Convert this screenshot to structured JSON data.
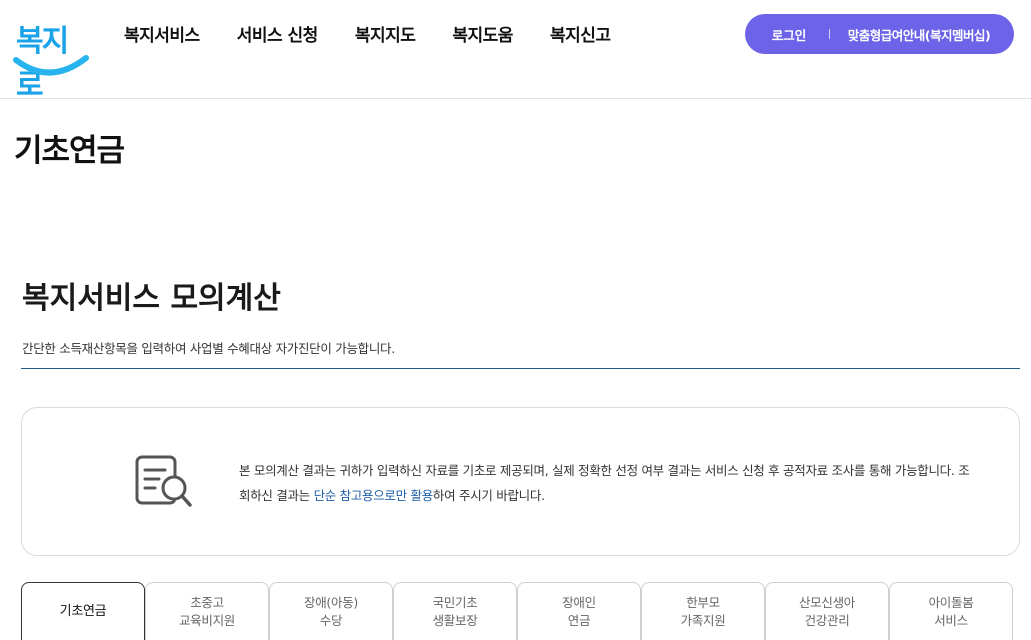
{
  "header": {
    "logo_text": "복지로",
    "nav": [
      "복지서비스",
      "서비스 신청",
      "복지지도",
      "복지도움",
      "복지신고"
    ],
    "login_label": "로그인",
    "member_label": "맞춤형급여안내(복지멤버십)",
    "accent_color": "#6c63e8"
  },
  "page": {
    "title": "기초연금"
  },
  "section": {
    "title": "복지서비스 모의계산",
    "description": "간단한 소득재산항목을 입력하여 사업별 수혜대상 자가진단이 가능합니다."
  },
  "notice": {
    "icon": "document-search-icon",
    "text_part1": "본 모의계산 결과는 귀하가 입력하신 자료를 기초로 제공되며, 실제 정확한 선정 여부 결과는 서비스 신청 후 공적자료 조사를 통해 가능합니다. 조회하신 결과는 ",
    "text_highlight": "단순 참고용으로만 활용",
    "text_part2": "하여 주시기 바랍니다."
  },
  "tabs": [
    {
      "lines": [
        "기초연금"
      ],
      "active": true
    },
    {
      "lines": [
        "초중고",
        "교육비지원"
      ],
      "active": false
    },
    {
      "lines": [
        "장애(아동)",
        "수당"
      ],
      "active": false
    },
    {
      "lines": [
        "국민기초",
        "생활보장"
      ],
      "active": false
    },
    {
      "lines": [
        "장애인",
        "연금"
      ],
      "active": false
    },
    {
      "lines": [
        "한부모",
        "가족지원"
      ],
      "active": false
    },
    {
      "lines": [
        "산모신생아",
        "건강관리"
      ],
      "active": false
    },
    {
      "lines": [
        "아이돌봄",
        "서비스"
      ],
      "active": false
    }
  ]
}
